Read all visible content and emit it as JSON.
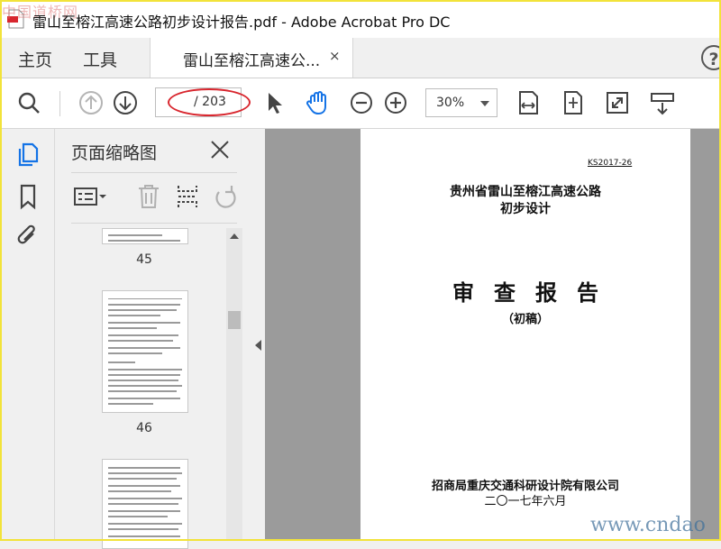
{
  "window": {
    "title": "雷山至榕江高速公路初步设计报告.pdf - Adobe Acrobat Pro DC",
    "watermark_top": "中国道桥网",
    "watermark_bottom": "www.cndao"
  },
  "tabs": {
    "home": "主页",
    "tools": "工具",
    "document": "雷山至榕江高速公...",
    "close": "×",
    "help": "?"
  },
  "toolbar": {
    "page_input": "",
    "page_total": "/ 203",
    "zoom": "30%",
    "icons": [
      "search-icon",
      "prev-page-icon",
      "next-page-icon",
      "select-cursor-icon",
      "hand-tool-icon",
      "zoom-out-icon",
      "zoom-in-icon",
      "fit-width-icon",
      "fit-page-icon",
      "fullscreen-icon",
      "more-tools-icon"
    ]
  },
  "rail": {
    "icons": [
      "page-thumbnails-icon",
      "bookmarks-icon",
      "attachments-icon"
    ]
  },
  "thumbnails_panel": {
    "title": "页面缩略图",
    "pages": [
      {
        "number": "45"
      },
      {
        "number": "46"
      },
      {
        "number": ""
      }
    ]
  },
  "document_page": {
    "code": "KS2017-26",
    "title_line1": "贵州省雷山至榕江高速公路",
    "title_line2": "初步设计",
    "heading": "审查报告",
    "status": "（初稿）",
    "organization": "招商局重庆交通科研设计院有限公司",
    "date": "二〇一七年六月"
  },
  "colors": {
    "accent_blue": "#1473e6",
    "highlight_red": "#d8262e",
    "window_border": "#f2e33a"
  }
}
